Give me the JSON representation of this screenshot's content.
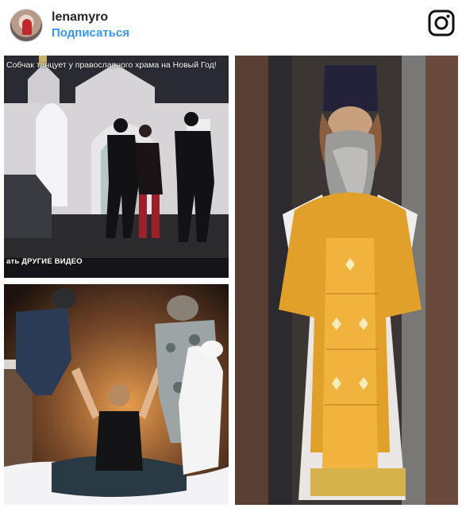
{
  "post": {
    "username": "lenamyro",
    "follow_label": "Подписаться"
  },
  "icons": {
    "avatar": "profile-avatar",
    "platform": "instagram-icon"
  },
  "colors": {
    "follow": "#3897f0",
    "username": "#262626",
    "vestment_gold": "#e0a02a"
  },
  "collage": {
    "video_title": "Собчак танцует у православного храма на Новый Год!",
    "video_more": "ать ДРУГИЕ ВИДЕО"
  }
}
